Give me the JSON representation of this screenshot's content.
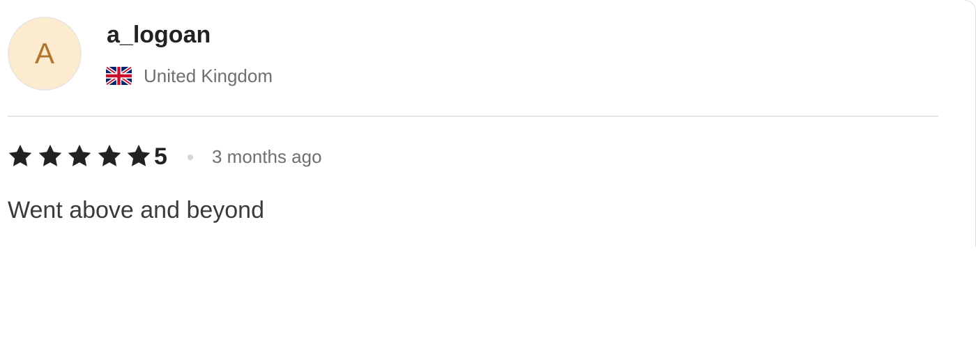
{
  "reviewer": {
    "initial": "A",
    "username": "a_logoan",
    "country": "United Kingdom",
    "flag_icon": "uk-flag-icon"
  },
  "review": {
    "rating_value": "5",
    "stars": 5,
    "time_ago": "3 months ago",
    "text": "Went above and beyond"
  },
  "colors": {
    "avatar_bg": "#fdebd0",
    "avatar_text": "#b0752c",
    "star": "#222222",
    "muted_text": "#6e6e73"
  }
}
